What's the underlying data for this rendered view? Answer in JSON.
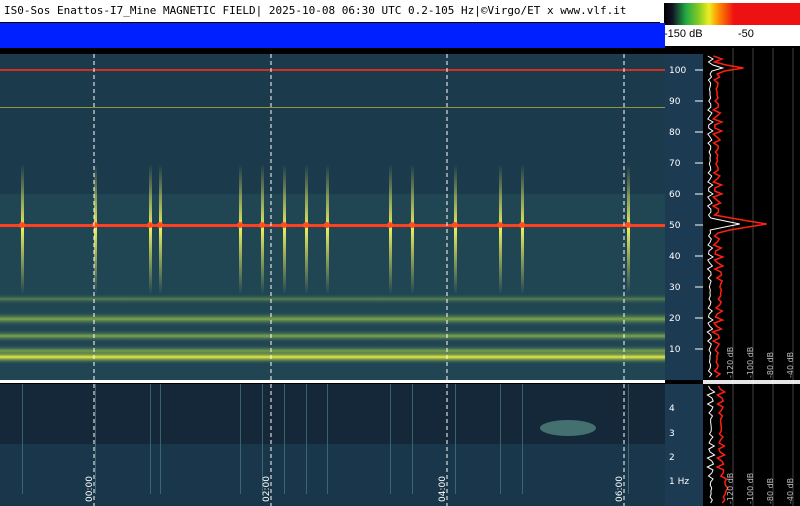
{
  "header": {
    "title": "IS0-Sos Enattos-I7_Mine MAGNETIC FIELD| 2025-10-08 06:30 UTC 0.2-105 Hz|©Virgo/ET x www.vlf.it"
  },
  "colorbar": {
    "min_label": "-150 dB",
    "max_label": "-50"
  },
  "freq_axis_top": {
    "labels": [
      "100",
      "90",
      "80",
      "70",
      "60",
      "50",
      "40",
      "30",
      "20",
      "10"
    ]
  },
  "freq_axis_bottom": {
    "labels": [
      "4",
      "3",
      "2",
      "1 Hz"
    ]
  },
  "time_axis": {
    "labels": [
      "00:00",
      "02:00",
      "04:00",
      "06:00"
    ]
  },
  "profile_scale_top": {
    "labels": [
      "-120 dB",
      "-100 dB",
      "-80 dB",
      "-40 dB"
    ]
  },
  "profile_scale_bottom": {
    "labels": [
      "-120 dB",
      "-100 dB",
      "-80 dB",
      "-40 dB"
    ]
  },
  "colors": {
    "background": "#000000",
    "spectrogram_base": "#1b3a4c",
    "blue_band": "#0020ff",
    "line_red": "#ff3020",
    "line_yellow": "#e8f030",
    "profile_red": "#ff2010",
    "profile_white": "#ffffff"
  }
}
